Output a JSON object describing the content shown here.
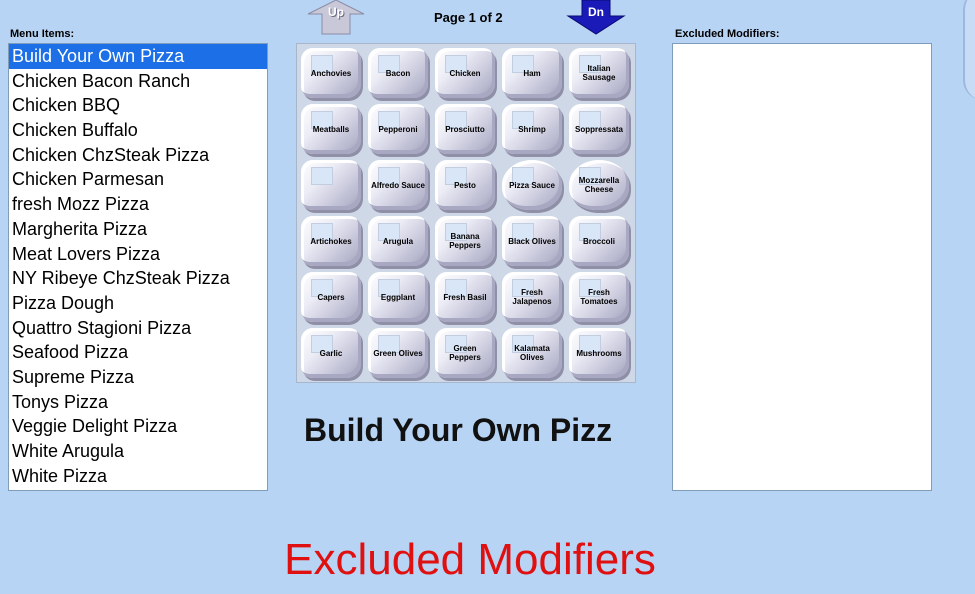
{
  "labels": {
    "menu_items": "Menu Items:",
    "excluded_modifiers": "Excluded Modifiers:",
    "page": "Page 1 of 2",
    "up": "Up",
    "down": "Dn"
  },
  "menu_items": [
    "Build Your Own Pizza",
    "Chicken Bacon Ranch",
    "Chicken BBQ",
    "Chicken Buffalo",
    "Chicken ChzSteak Pizza",
    "Chicken Parmesan",
    "fresh Mozz Pizza",
    "Margherita Pizza",
    "Meat Lovers Pizza",
    "NY Ribeye ChzSteak Pizza",
    "Pizza Dough",
    "Quattro Stagioni Pizza",
    "Seafood Pizza",
    "Supreme Pizza",
    "Tonys Pizza",
    "Veggie Delight Pizza",
    "White Arugula",
    "White Pizza"
  ],
  "selected_index": 0,
  "modifiers": [
    [
      "Anchovies",
      "Bacon",
      "Chicken",
      "Ham",
      "Italian Sausage"
    ],
    [
      "Meatballs",
      "Pepperoni",
      "Prosciutto",
      "Shrimp",
      "Soppressata"
    ],
    [
      "",
      "Alfredo Sauce",
      "Pesto",
      "Pizza Sauce",
      "Mozzarella Cheese"
    ],
    [
      "Artichokes",
      "Arugula",
      "Banana Peppers",
      "Black Olives",
      "Broccoli"
    ],
    [
      "Capers",
      "Eggplant",
      "Fresh Basil",
      "Fresh Jalapenos",
      "Fresh Tomatoes"
    ],
    [
      "Garlic",
      "Green Olives",
      "Green Peppers",
      "Kalamata Olives",
      "Mushrooms"
    ]
  ],
  "selected_item_display": "Build Your Own Pizz",
  "excluded_modifiers": [],
  "screen_title": "Excluded Modifiers",
  "colors": {
    "background": "#b7d4f4",
    "selection": "#1c6fe6",
    "title": "#e01010",
    "down_arrow": "#1a1ab8",
    "up_arrow": "#c8c8d8"
  }
}
